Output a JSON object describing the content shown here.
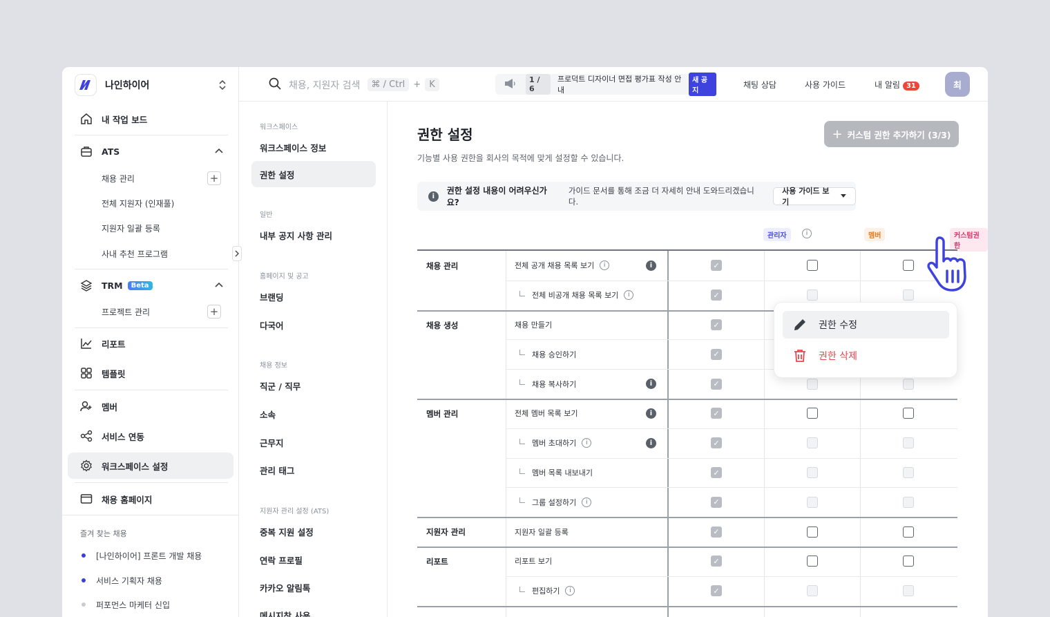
{
  "workspace": {
    "name": "나인하이어"
  },
  "sidebar": {
    "dashboard": "내 작업 보드",
    "ats": {
      "label": "ATS",
      "items": [
        "채용 관리",
        "전체 지원자 (인재풀)",
        "지원자 일괄 등록",
        "사내 추천 프로그램"
      ]
    },
    "trm": {
      "label": "TRM",
      "badge": "Beta",
      "items": [
        "프로젝트 관리"
      ]
    },
    "report": "리포트",
    "template": "템플릿",
    "member": "멤버",
    "integration": "서비스 연동",
    "workspace_settings": "워크스페이스 설정",
    "homepage": "채용 홈페이지",
    "favorites": {
      "title": "즐겨 찾는 채용",
      "items": [
        "[나인하이어] 프론트 개발 채용",
        "서비스 기획자 채용",
        "퍼포먼스 마케터 신입"
      ]
    }
  },
  "topbar": {
    "search_placeholder": "채용, 지원자 검색",
    "shortcut_key1": "⌘ / Ctrl",
    "shortcut_plus": "+",
    "shortcut_key2": "K",
    "notice_pager": "1 / 6",
    "notice_text": "프로덕트 디자이너 면접 평가표 작성 안내",
    "notice_badge": "새 공지",
    "chat": "채팅 상담",
    "guide": "사용 가이드",
    "alarm": "내 알림",
    "alarm_count": "31",
    "avatar": "최"
  },
  "subnav": {
    "groups": [
      {
        "title": "워크스페이스",
        "items": [
          "워크스페이스 정보",
          "권한 설정"
        ]
      },
      {
        "title": "일반",
        "items": [
          "내부 공지 사항 관리"
        ]
      },
      {
        "title": "홈페이지 및 공고",
        "items": [
          "브랜딩",
          "다국어"
        ]
      },
      {
        "title": "채용 정보",
        "items": [
          "직군 / 직무",
          "소속",
          "근무지",
          "관리 태그"
        ]
      },
      {
        "title": "지원자 관리 설정 (ATS)",
        "items": [
          "중복 지원 설정",
          "연락 프로필",
          "카카오 알림톡",
          "메시지창 사용"
        ]
      }
    ]
  },
  "main": {
    "title": "권한 설정",
    "description": "기능별 사용 권한을 회사의 목적에 맞게 설정할 수 있습니다.",
    "add_button": "커스텀 권한 추가하기 (3/3)",
    "help_question": "권한 설정 내용이 어려우신가요?",
    "help_text": "가이드 문서를 통해 조금 더 자세히 안내 도와드리겠습니다.",
    "help_button": "사용 가이드 보기",
    "roles": [
      "관리자",
      "멤버",
      "커스텀권한"
    ],
    "more_button": "•••"
  },
  "permissions": {
    "categories": [
      "채용 관리",
      "채용 생성",
      "멤버 관리",
      "지원자 관리",
      "리포트"
    ],
    "rows": [
      "전체 공개 채용 목록 보기",
      "전체 비공개 채용 목록 보기",
      "채용 만들기",
      "채용 승인하기",
      "채용 복사하기",
      "전체 멤버 목록 보기",
      "멤버 초대하기",
      "멤버 목록 내보내기",
      "그룹 설정하기",
      "지원자 일괄 등록",
      "리포트 보기",
      "편집하기"
    ]
  },
  "dropdown": {
    "edit": "권한 수정",
    "delete": "권한 삭제"
  },
  "colors": {
    "accent": "#3f43de",
    "danger": "#e5484d",
    "admin_badge": "#4b4fd6",
    "member_badge": "#e07b22",
    "custom_badge": "#d9346a"
  }
}
